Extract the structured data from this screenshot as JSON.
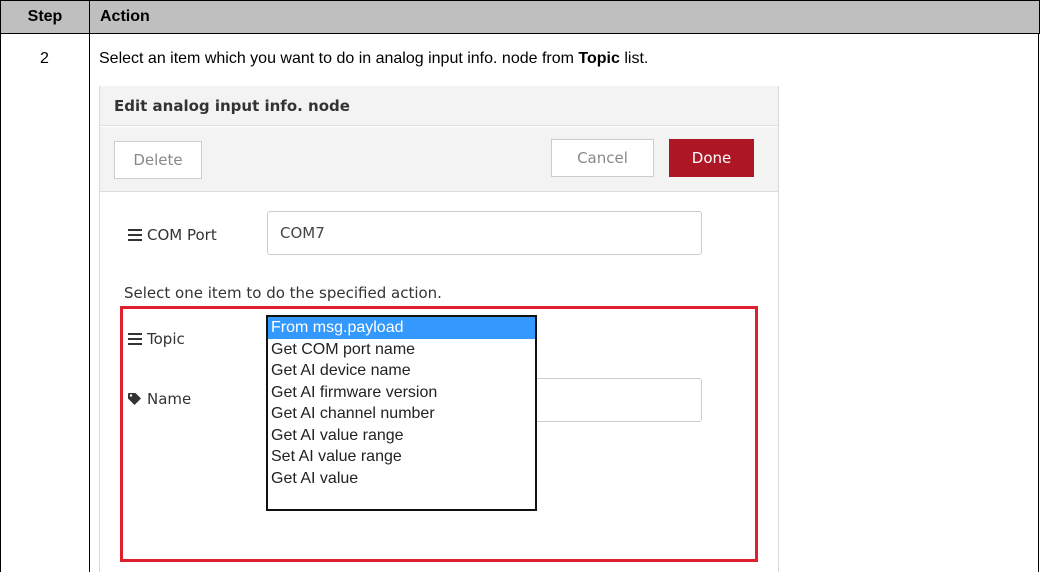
{
  "table": {
    "header_step": "Step",
    "header_action": "Action",
    "step_number": "2",
    "action_prefix": "Select an item which you want to do in analog input info. node from ",
    "action_bold": "Topic",
    "action_suffix": " list."
  },
  "dialog": {
    "title": "Edit analog input info. node",
    "delete_label": "Delete",
    "cancel_label": "Cancel",
    "done_label": "Done",
    "com_port_label": "COM Port",
    "com_port_value": "COM7",
    "helper_text": "Select one item to do the specified action.",
    "topic_label": "Topic",
    "name_label": "Name",
    "topic_options": [
      "From msg.payload",
      "Get COM port name",
      "Get AI device name",
      "Get AI firmware version",
      "Get AI channel number",
      "Get AI value range",
      "Set AI value range",
      "Get AI value"
    ],
    "topic_selected": "From msg.payload",
    "colors": {
      "done_bg": "#ad1625",
      "highlight": "#e0202e",
      "selected_option": "#3399ff"
    }
  }
}
